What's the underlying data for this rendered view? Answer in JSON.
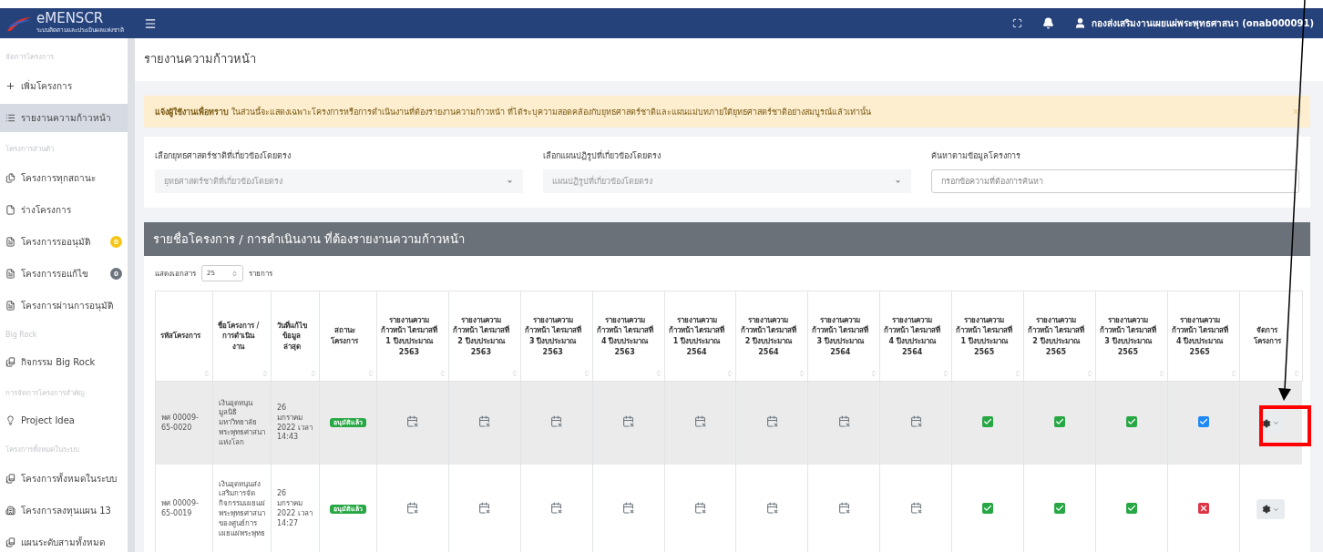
{
  "topbar": {
    "logo_title": "eMENSCR",
    "logo_subtitle": "ระบบติดตามและประเมินผลแห่งชาติ",
    "user": "กองส่งเสริมงานเผยแผ่พระพุทธศาสนา (onab000091)"
  },
  "sidebar": [
    {
      "kind": "heading",
      "label": "จัดการโครงการ"
    },
    {
      "kind": "item",
      "label": "เพิ่มโครงการ",
      "selected": false
    },
    {
      "kind": "item",
      "label": "รายงานความก้าวหน้า",
      "selected": true
    },
    {
      "kind": "heading",
      "label": "โครงการส่วนตัว"
    },
    {
      "kind": "item",
      "label": "โครงการทุกสถานะ",
      "selected": false
    },
    {
      "kind": "item",
      "label": "ร่างโครงการ",
      "selected": false
    },
    {
      "kind": "item",
      "label": "โครงการรออนุมัติ",
      "selected": false,
      "badge": "0",
      "color": "#f5c518"
    },
    {
      "kind": "item",
      "label": "โครงการรอแก้ไข",
      "selected": false,
      "badge": "0",
      "color": "#6c757d"
    },
    {
      "kind": "item",
      "label": "โครงการผ่านการอนุมัติ",
      "selected": false
    },
    {
      "kind": "heading",
      "label": "Big Rock"
    },
    {
      "kind": "item",
      "label": "กิจกรรม Big Rock",
      "selected": false
    },
    {
      "kind": "heading",
      "label": "การจัดการโครงการสำคัญ"
    },
    {
      "kind": "item",
      "label": "Project Idea",
      "selected": false
    },
    {
      "kind": "heading",
      "label": "โครงการทั้งหมดในระบบ"
    },
    {
      "kind": "item",
      "label": "โครงการทั้งหมดในระบบ",
      "selected": false
    },
    {
      "kind": "item",
      "label": "โครงการลงทุนแผน 13",
      "selected": false
    },
    {
      "kind": "item",
      "label": "แผนระดับสามทั้งหมด",
      "selected": false
    }
  ],
  "page_title": "รายงานความก้าวหน้า",
  "alert": {
    "text": "**แจ้งผู้ใช้งานเพื่อทราบ** ในส่วนนี้จะแสดงเฉพาะโครงการหรือการดำเนินงานที่ต้องรายงานความก้าวหน้า ที่ได้ระบุความสอดคล้องกับยุทธศาสตร์ชาติและแผนแม่บทภายใต้ยุทธศาสตร์ชาติอย่างสมบูรณ์แล้วเท่านั้น",
    "close": "×"
  },
  "filters": [
    {
      "kind": "select",
      "label": "เลือกยุทธศาสตร์ชาติที่เกี่ยวข้องโดยตรง",
      "placeholder": "ยุทธศาสตร์ชาติที่เกี่ยวข้องโดยตรง"
    },
    {
      "kind": "select",
      "label": "เลือกแผนปฏิรูปที่เกี่ยวข้องโดยตรง",
      "placeholder": "แผนปฏิรูปที่เกี่ยวข้องโดยตรง"
    },
    {
      "kind": "text",
      "label": "ค้นหาตามข้อมูลโครงการ",
      "placeholder": "กรอกข้อความที่ต้องการค้นหา"
    }
  ],
  "table_card": {
    "title": "รายชื่อโครงการ / การดำเนินงาน ที่ต้องรายงานความก้าวหน้า",
    "show_label": "แสดงเอกสาร",
    "page_size": "25",
    "unit": "รายการ"
  },
  "columns": [
    "รหัสโครงการ",
    "ชื่อโครงการ / การดำเนินงาน",
    "วันที่แก้ไขข้อมูลล่าสุด",
    "สถานะโครงการ",
    "รายงานความก้าวหน้า ไตรมาสที่ 1 ปีงบประมาณ 2563",
    "รายงานความก้าวหน้า ไตรมาสที่ 2 ปีงบประมาณ 2563",
    "รายงานความก้าวหน้า ไตรมาสที่ 3 ปีงบประมาณ 2563",
    "รายงานความก้าวหน้า ไตรมาสที่ 4 ปีงบประมาณ 2563",
    "รายงานความก้าวหน้า ไตรมาสที่ 1 ปีงบประมาณ 2564",
    "รายงานความก้าวหน้า ไตรมาสที่ 2 ปีงบประมาณ 2564",
    "รายงานความก้าวหน้า ไตรมาสที่ 3 ปีงบประมาณ 2564",
    "รายงานความก้าวหน้า ไตรมาสที่ 4 ปีงบประมาณ 2564",
    "รายงานความก้าวหน้า ไตรมาสที่ 1 ปีงบประมาณ 2565",
    "รายงานความก้าวหน้า ไตรมาสที่ 2 ปีงบประมาณ 2565",
    "รายงานความก้าวหน้า ไตรมาสที่ 3 ปีงบประมาณ 2565",
    "รายงานความก้าวหน้า ไตรมาสที่ 4 ปีงบประมาณ 2565",
    "จัดการโครงการ"
  ],
  "rows": [
    {
      "selected": true,
      "code": "พศ 00009-65-0020",
      "name": "เงินอุดหนุน มูลนิธิ มหาวิทยาลัย พระพุทธศาสนา แห่งโลก",
      "date": "26 มกราคม 2022 เวลา 14:43",
      "status": "อนุมัติแล้ว",
      "reports": [
        {
          "kind": "empty"
        },
        {
          "kind": "empty"
        },
        {
          "kind": "empty"
        },
        {
          "kind": "empty"
        },
        {
          "kind": "empty"
        },
        {
          "kind": "empty"
        },
        {
          "kind": "empty"
        },
        {
          "kind": "empty"
        },
        {
          "kind": "done"
        },
        {
          "kind": "done"
        },
        {
          "kind": "done"
        },
        {
          "kind": "current"
        }
      ]
    },
    {
      "selected": false,
      "code": "พศ 00009-65-0019",
      "name": "เงินอุดหนุนส่ง เสริมการจัด กิจกรรมเผยแผ่ พระพุทธศาสนา ของศูนย์การ เผยแผ่พระพุทธ",
      "date": "26 มกราคม 2022 เวลา 14:27",
      "status": "อนุมัติแล้ว",
      "reports": [
        {
          "kind": "empty"
        },
        {
          "kind": "empty"
        },
        {
          "kind": "empty"
        },
        {
          "kind": "empty"
        },
        {
          "kind": "empty"
        },
        {
          "kind": "empty"
        },
        {
          "kind": "empty"
        },
        {
          "kind": "empty"
        },
        {
          "kind": "done"
        },
        {
          "kind": "done"
        },
        {
          "kind": "done"
        },
        {
          "kind": "missing"
        }
      ]
    }
  ]
}
